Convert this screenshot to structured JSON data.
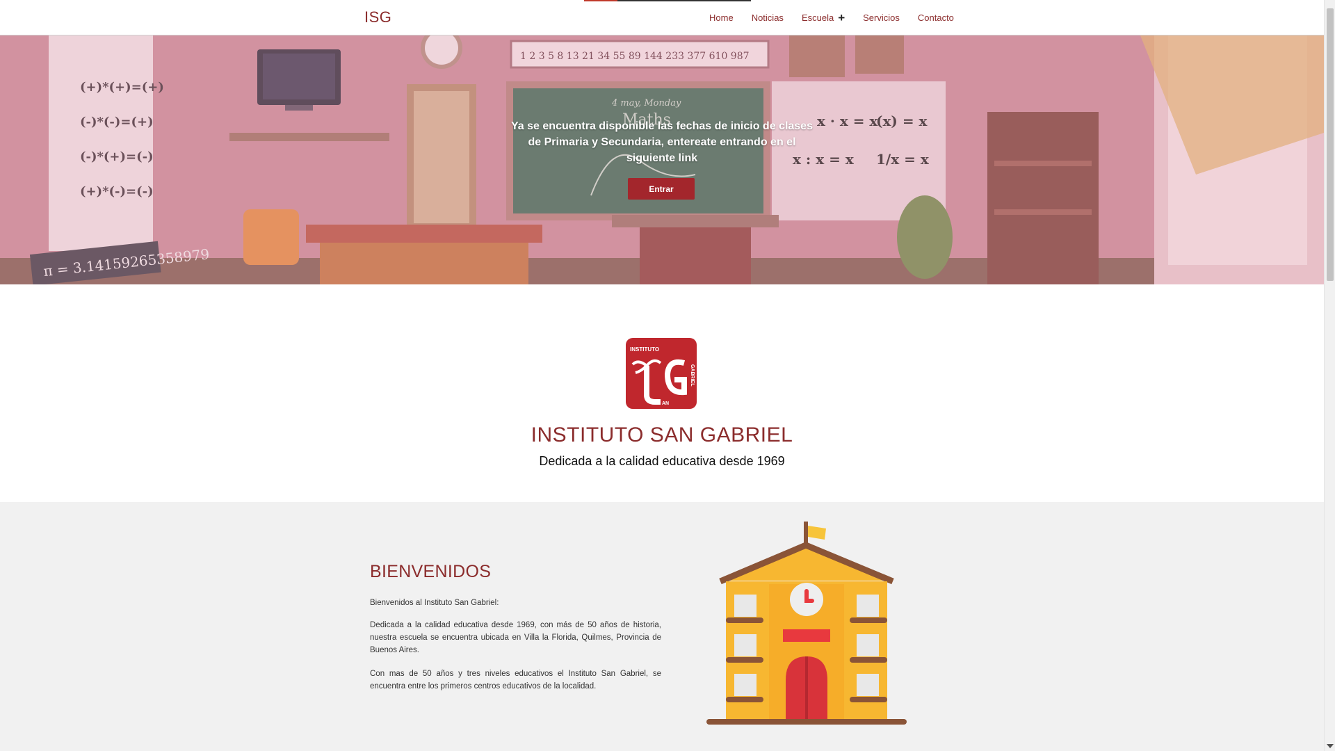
{
  "navbar": {
    "brand": "ISG",
    "links": [
      {
        "label": "Home"
      },
      {
        "label": "Noticias"
      },
      {
        "label": "Escuela",
        "icon": "plus-icon"
      },
      {
        "label": "Servicios"
      },
      {
        "label": "Contacto"
      }
    ]
  },
  "hero": {
    "message": "Ya se encuentra disponible las fechas de inicio de clases de Primaria y Secundaria, entereate entrando en el siguiente link",
    "button_label": "Entrar",
    "background": {
      "board_date": "4 may, Monday",
      "board_subject": "Maths",
      "fibonacci": [
        "1",
        "2",
        "3",
        "5",
        "8",
        "13",
        "21",
        "34",
        "55",
        "89",
        "144",
        "233",
        "377",
        "610",
        "987"
      ],
      "sign_rules": [
        "(+)*(+)=(+)",
        "(-)*(-)=(+)",
        "(-)*(+)=(-)",
        "(+)*(-)=(-)"
      ],
      "pi": "π = 3.14159265358979",
      "formulas": [
        "x^a · x^b = x^(a+b)",
        "(x^a)^b = x^(a·b)",
        "x^a : x^b = x^(a-b)",
        "1/x^a = x^-a"
      ]
    }
  },
  "intro": {
    "logo_text": [
      "INSTITUTO",
      "GABRIEL",
      "AN"
    ],
    "title": "INSTITUTO SAN GABRIEL",
    "subtitle": "Dedicada a la calidad educativa desde 1969"
  },
  "welcome": {
    "title": "BIENVENIDOS",
    "paragraphs": [
      "Bienvenidos al Instituto San Gabriel:",
      "Dedicada a la calidad educativa desde 1969, con más de 50 años de historia, nuestra escuela se encuentra ubicada en Villa la Florida, Quilmes, Provincia de Buenos Aires.",
      "Con mas de 50 años y tres niveles educativos el Instituto San Gabriel, se encuentra entre los primeros centros educativos de la localidad."
    ]
  },
  "colors": {
    "brand": "#8b2c2c",
    "button": "#a3262c",
    "hero_overlay": "#d89aa6",
    "section_gray": "#f1f1f1",
    "school_yellow": "#f7b731",
    "school_brown": "#8a5437"
  }
}
